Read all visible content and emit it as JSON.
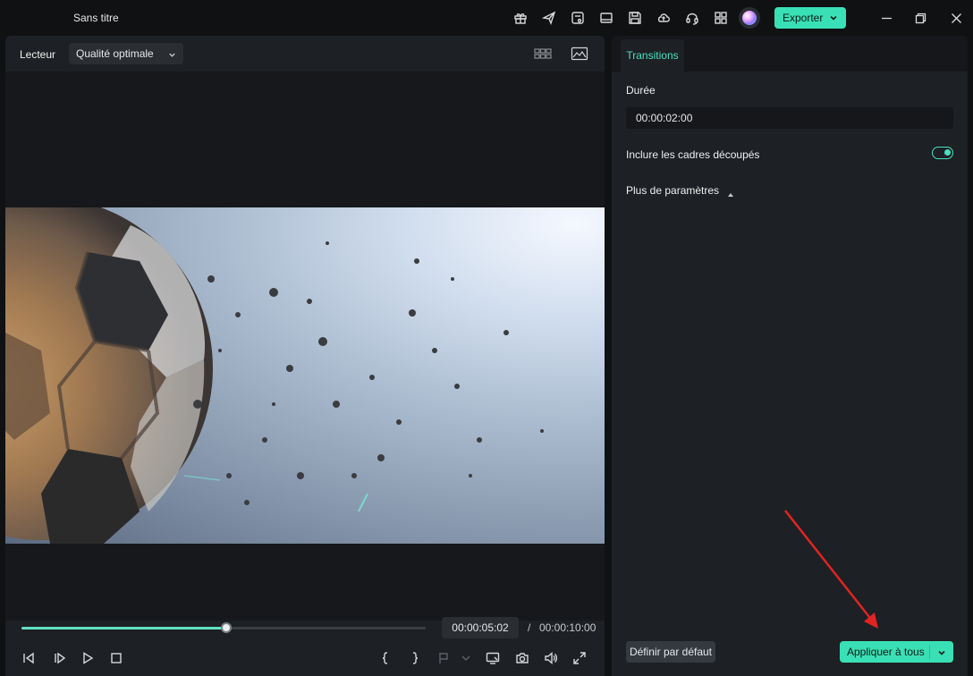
{
  "window": {
    "title": "Sans titre",
    "export_label": "Exporter",
    "toolbar_icons": [
      "gift-icon",
      "send-icon",
      "media-icon",
      "layout-icon",
      "save-icon",
      "cloud-upload-icon",
      "headset-icon",
      "grid-icon"
    ]
  },
  "player": {
    "label": "Lecteur",
    "quality": "Qualité optimale",
    "current_time": "00:00:05:02",
    "separator": "/",
    "total_time": "00:00:10:00",
    "progress_fraction": 0.507
  },
  "transitions_panel": {
    "tab_label": "Transitions",
    "duration_label": "Durée",
    "duration_value": "00:00:02:00",
    "include_trimmed_label": "Inclure les cadres découpés",
    "include_trimmed_on": true,
    "more_params_label": "Plus de paramètres",
    "default_button": "Définir par défaut",
    "apply_all_button": "Appliquer à tous"
  },
  "colors": {
    "accent": "#39e0b5",
    "panel_bg": "#1d2024",
    "window_bg": "#0f1113",
    "annotation_arrow": "#e02424"
  }
}
